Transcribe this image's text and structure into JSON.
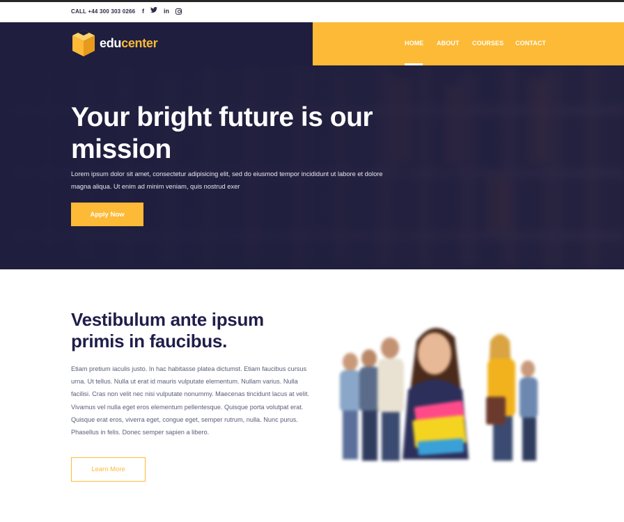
{
  "topbar": {
    "call_text": "CALL +44 300 303 0266",
    "socials": [
      "facebook-icon",
      "twitter-icon",
      "linkedin-icon",
      "instagram-icon"
    ]
  },
  "logo": {
    "part1": "edu",
    "part2": "center"
  },
  "nav": {
    "items": [
      {
        "label": "HOME",
        "active": true
      },
      {
        "label": "ABOUT",
        "active": false
      },
      {
        "label": "COURSES",
        "active": false
      },
      {
        "label": "CONTACT",
        "active": false
      }
    ]
  },
  "hero": {
    "title": "Your bright future is our mission",
    "text": "Lorem ipsum dolor sit amet, consectetur adipisicing elit, sed do eiusmod tempor incididunt ut labore et dolore magna aliqua. Ut enim ad minim veniam, quis nostrud exer",
    "button": "Apply Now"
  },
  "about": {
    "title": "Vestibulum ante ipsum primis in faucibus.",
    "text": "Etiam pretium iaculis justo. In hac habitasse platea dictumst. Etiam faucibus cursus urna. Ut tellus. Nulla ut erat id mauris vulputate elementum. Nullam varius. Nulla facilisi. Cras non velit nec nisi vulputate nonummy. Maecenas tincidunt lacus at velit. Vivamus vel nulla eget eros elementum pellentesque. Quisque porta volutpat erat. Quisque erat eros, viverra eget, congue eget, semper rutrum, nulla. Nunc purus. Phasellus in felis. Donec semper sapien a libero.",
    "button": "Learn More"
  },
  "colors": {
    "accent": "#fcba36",
    "navy": "#1f1e3f",
    "heading": "#1f1e4a"
  }
}
